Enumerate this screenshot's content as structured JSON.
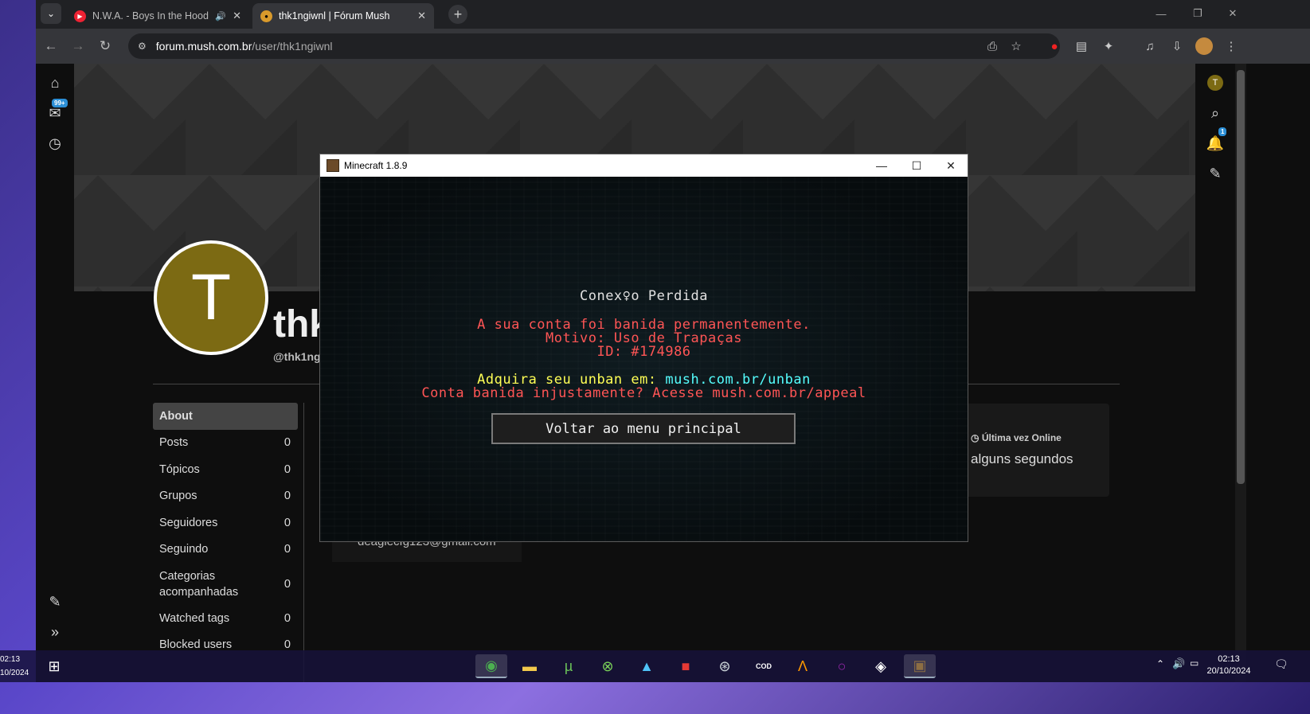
{
  "browser": {
    "tabs": [
      {
        "title": "N.W.A. - Boys In the Hood",
        "active": false
      },
      {
        "title": "thk1ngiwnl | Fórum Mush",
        "active": true
      }
    ],
    "url_host": "forum.mush.com.br",
    "url_path": "/user/thk1ngiwnl"
  },
  "left_rail": {
    "inbox_badge": "99+"
  },
  "right_rail": {
    "avatar_letter": "T",
    "notif_badge": "1"
  },
  "profile": {
    "avatar_letter": "T",
    "username": "thk",
    "handle": "@thk1ng",
    "nav": [
      {
        "label": "About",
        "count": ""
      },
      {
        "label": "Posts",
        "count": "0"
      },
      {
        "label": "Tópicos",
        "count": "0"
      },
      {
        "label": "Grupos",
        "count": "0"
      },
      {
        "label": "Seguidores",
        "count": "0"
      },
      {
        "label": "Seguindo",
        "count": "0"
      },
      {
        "label": "Categorias acompanhadas",
        "count": "0"
      },
      {
        "label": "Watched tags",
        "count": "0"
      },
      {
        "label": "Blocked users",
        "count": "0"
      }
    ],
    "last_online_label": "Última vez Online",
    "last_online_value": "alguns segundos",
    "email_partial": "deaglecfg123@gmail.com"
  },
  "minecraft": {
    "window_title": "Minecraft 1.8.9",
    "heading": "Conex♀o Perdida",
    "line1": "A sua conta foi banida permanentemente.",
    "line2": "Motivo: Uso de Trapaças",
    "line3": "ID: #174986",
    "unban_prefix": "Adquira seu unban em: ",
    "unban_link": "mush.com.br/unban",
    "appeal": "Conta banida injustamente? Acesse mush.com.br/appeal",
    "button": "Voltar ao menu principal"
  },
  "desktop": {
    "left_clock_time": "02:13",
    "left_clock_date": "10/2024",
    "tray_time": "02:13",
    "tray_date": "20/10/2024"
  }
}
